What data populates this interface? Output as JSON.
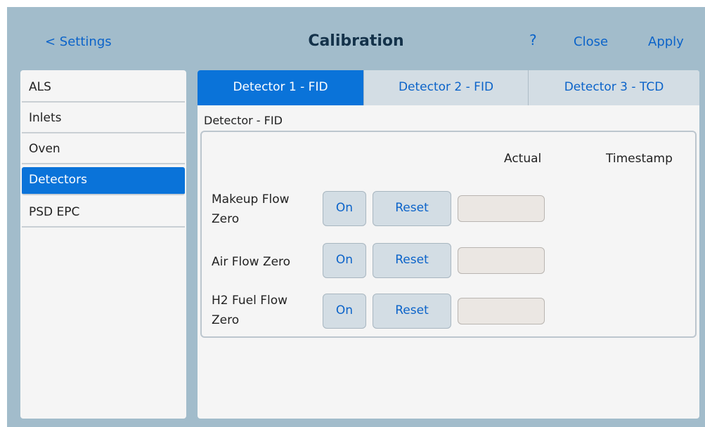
{
  "header": {
    "back_label": "< Settings",
    "title": "Calibration",
    "help_label": "?",
    "close_label": "Close",
    "apply_label": "Apply"
  },
  "sidebar": {
    "items": [
      {
        "label": "ALS"
      },
      {
        "label": "Inlets"
      },
      {
        "label": "Oven"
      },
      {
        "label": "Detectors",
        "active": true
      },
      {
        "label": "PSD EPC"
      }
    ]
  },
  "tabs": [
    {
      "label": "Detector 1 - FID",
      "active": true
    },
    {
      "label": "Detector 2 - FID"
    },
    {
      "label": "Detector 3 - TCD"
    }
  ],
  "section_label": "Detector - FID",
  "table": {
    "col_actual": "Actual",
    "col_timestamp": "Timestamp",
    "rows": [
      {
        "label_line1": "Makeup Flow",
        "label_line2": "Zero",
        "on_label": "On",
        "reset_label": "Reset",
        "actual": ""
      },
      {
        "label_line1": "Air Flow Zero",
        "label_line2": "",
        "on_label": "On",
        "reset_label": "Reset",
        "actual": ""
      },
      {
        "label_line1": "H2 Fuel Flow",
        "label_line2": "Zero",
        "on_label": "On",
        "reset_label": "Reset",
        "actual": ""
      }
    ]
  },
  "colors": {
    "accent": "#0a73d9",
    "link": "#0b63c9",
    "background": "#a2bccb",
    "panel": "#f5f5f5"
  }
}
